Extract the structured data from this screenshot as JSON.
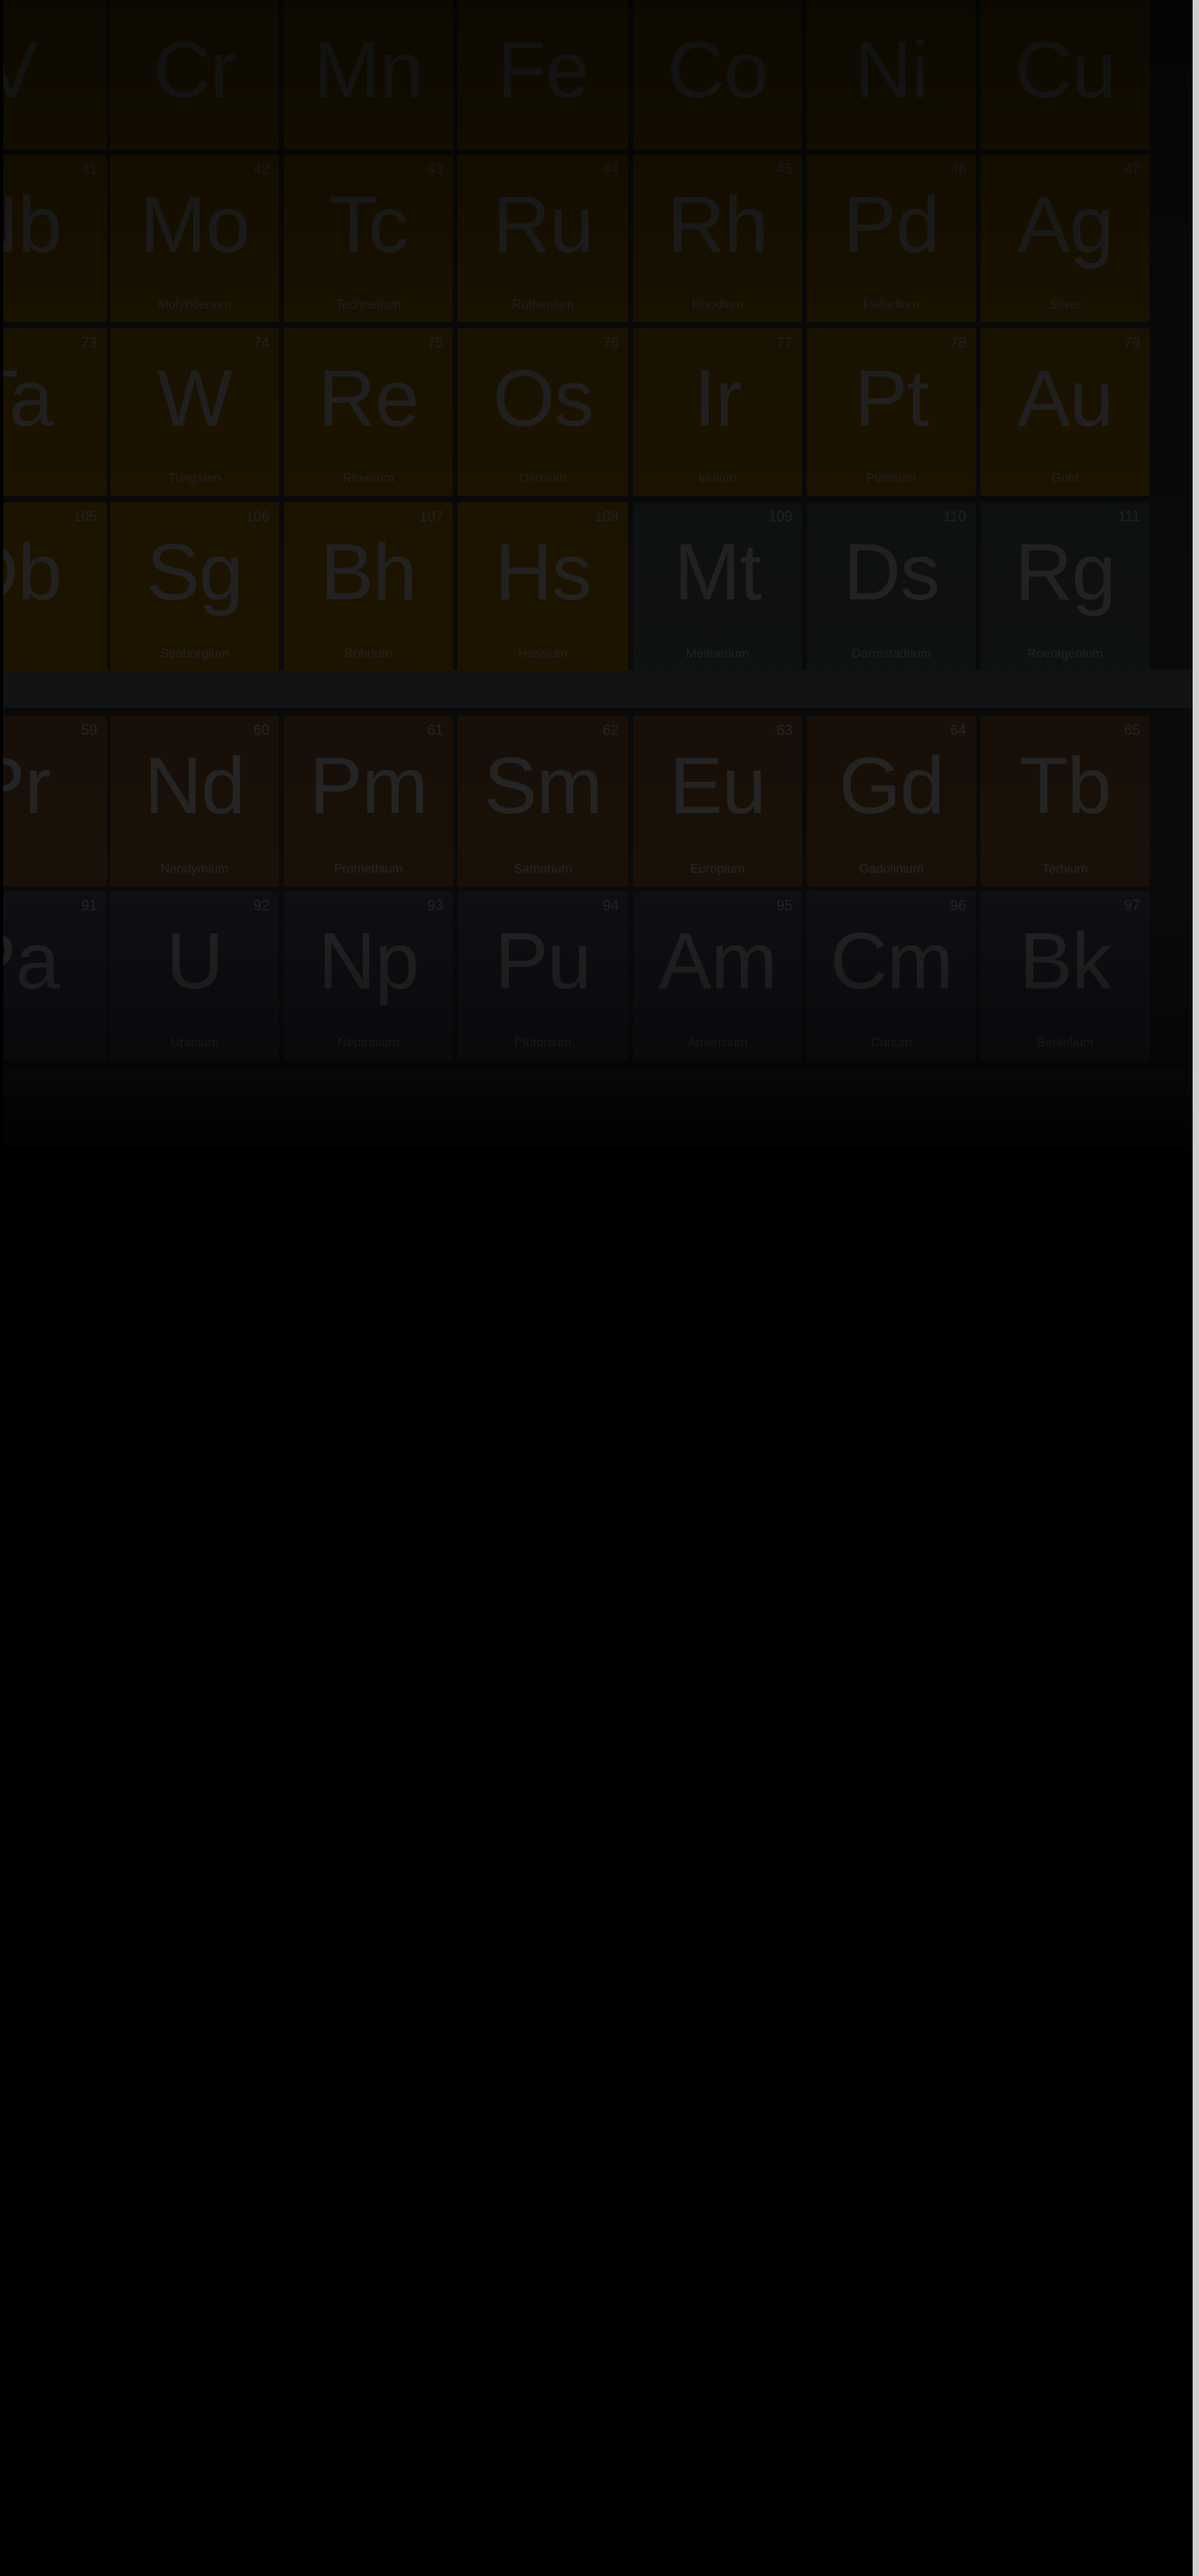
{
  "palette": {
    "transition": "#5c3f00",
    "unknown": "#2c3733",
    "lanthanide": "#4a3118",
    "actinide": "#2a2f3a",
    "text": "#6d6d6d"
  },
  "rows": [
    {
      "group": "transition",
      "cells": [
        {
          "symbol": "V",
          "name": "",
          "number": "",
          "mass": ""
        },
        {
          "symbol": "Cr",
          "name": "",
          "number": "",
          "mass": ""
        },
        {
          "symbol": "Mn",
          "name": "",
          "number": "",
          "mass": ""
        },
        {
          "symbol": "Fe",
          "name": "",
          "number": "",
          "mass": ""
        },
        {
          "symbol": "Co",
          "name": "",
          "number": "",
          "mass": ""
        },
        {
          "symbol": "Ni",
          "name": "",
          "number": "",
          "mass": ""
        },
        {
          "symbol": "Cu",
          "name": "",
          "number": "",
          "mass": ""
        }
      ]
    },
    {
      "group": "transition",
      "cells": [
        {
          "symbol": "Nb",
          "name": "",
          "number": "41",
          "mass": ""
        },
        {
          "symbol": "Mo",
          "name": "Molybdenum",
          "number": "42",
          "mass": ""
        },
        {
          "symbol": "Tc",
          "name": "Technetium",
          "number": "43",
          "mass": ""
        },
        {
          "symbol": "Ru",
          "name": "Ruthenium",
          "number": "44",
          "mass": ""
        },
        {
          "symbol": "Rh",
          "name": "Rhodium",
          "number": "45",
          "mass": ""
        },
        {
          "symbol": "Pd",
          "name": "Palladium",
          "number": "46",
          "mass": ""
        },
        {
          "symbol": "Ag",
          "name": "Silver",
          "number": "47",
          "mass": ""
        }
      ]
    },
    {
      "group": "transition",
      "cells": [
        {
          "symbol": "Ta",
          "name": "",
          "number": "73",
          "mass": ""
        },
        {
          "symbol": "W",
          "name": "Tungsten",
          "number": "74",
          "mass": ""
        },
        {
          "symbol": "Re",
          "name": "Rhenium",
          "number": "75",
          "mass": ""
        },
        {
          "symbol": "Os",
          "name": "Osmium",
          "number": "76",
          "mass": ""
        },
        {
          "symbol": "Ir",
          "name": "Iridium",
          "number": "77",
          "mass": ""
        },
        {
          "symbol": "Pt",
          "name": "Platinum",
          "number": "78",
          "mass": ""
        },
        {
          "symbol": "Au",
          "name": "Gold",
          "number": "79",
          "mass": ""
        }
      ]
    },
    {
      "group": "transition",
      "cells": [
        {
          "symbol": "Db",
          "name": "",
          "number": "105",
          "mass": ""
        },
        {
          "symbol": "Sg",
          "name": "Seaborgium",
          "number": "106",
          "mass": ""
        },
        {
          "symbol": "Bh",
          "name": "Bohrium",
          "number": "107",
          "mass": ""
        },
        {
          "symbol": "Hs",
          "name": "Hassium",
          "number": "108",
          "mass": ""
        },
        {
          "symbol": "Mt",
          "name": "Meitnerium",
          "number": "109",
          "mass": "",
          "group": "unknown"
        },
        {
          "symbol": "Ds",
          "name": "Darmstadtium",
          "number": "110",
          "mass": "",
          "group": "unknown"
        },
        {
          "symbol": "Rg",
          "name": "Roentgenium",
          "number": "111",
          "mass": "",
          "group": "unknown"
        }
      ]
    },
    {
      "group": "lanthanide",
      "cells": [
        {
          "symbol": "Pr",
          "name": "",
          "number": "59",
          "mass": ""
        },
        {
          "symbol": "Nd",
          "name": "Neodymium",
          "number": "60",
          "mass": ""
        },
        {
          "symbol": "Pm",
          "name": "Promethium",
          "number": "61",
          "mass": ""
        },
        {
          "symbol": "Sm",
          "name": "Samarium",
          "number": "62",
          "mass": ""
        },
        {
          "symbol": "Eu",
          "name": "Europium",
          "number": "63",
          "mass": ""
        },
        {
          "symbol": "Gd",
          "name": "Gadolinium",
          "number": "64",
          "mass": ""
        },
        {
          "symbol": "Tb",
          "name": "Terbium",
          "number": "65",
          "mass": ""
        }
      ]
    },
    {
      "group": "actinide",
      "cells": [
        {
          "symbol": "Pa",
          "name": "",
          "number": "91",
          "mass": ""
        },
        {
          "symbol": "U",
          "name": "Uranium",
          "number": "92",
          "mass": ""
        },
        {
          "symbol": "Np",
          "name": "Neptunium",
          "number": "93",
          "mass": ""
        },
        {
          "symbol": "Pu",
          "name": "Plutonium",
          "number": "94",
          "mass": ""
        },
        {
          "symbol": "Am",
          "name": "Americium",
          "number": "95",
          "mass": ""
        },
        {
          "symbol": "Cm",
          "name": "Curium",
          "number": "96",
          "mass": ""
        },
        {
          "symbol": "Bk",
          "name": "Berkelium",
          "number": "97",
          "mass": ""
        }
      ]
    }
  ]
}
